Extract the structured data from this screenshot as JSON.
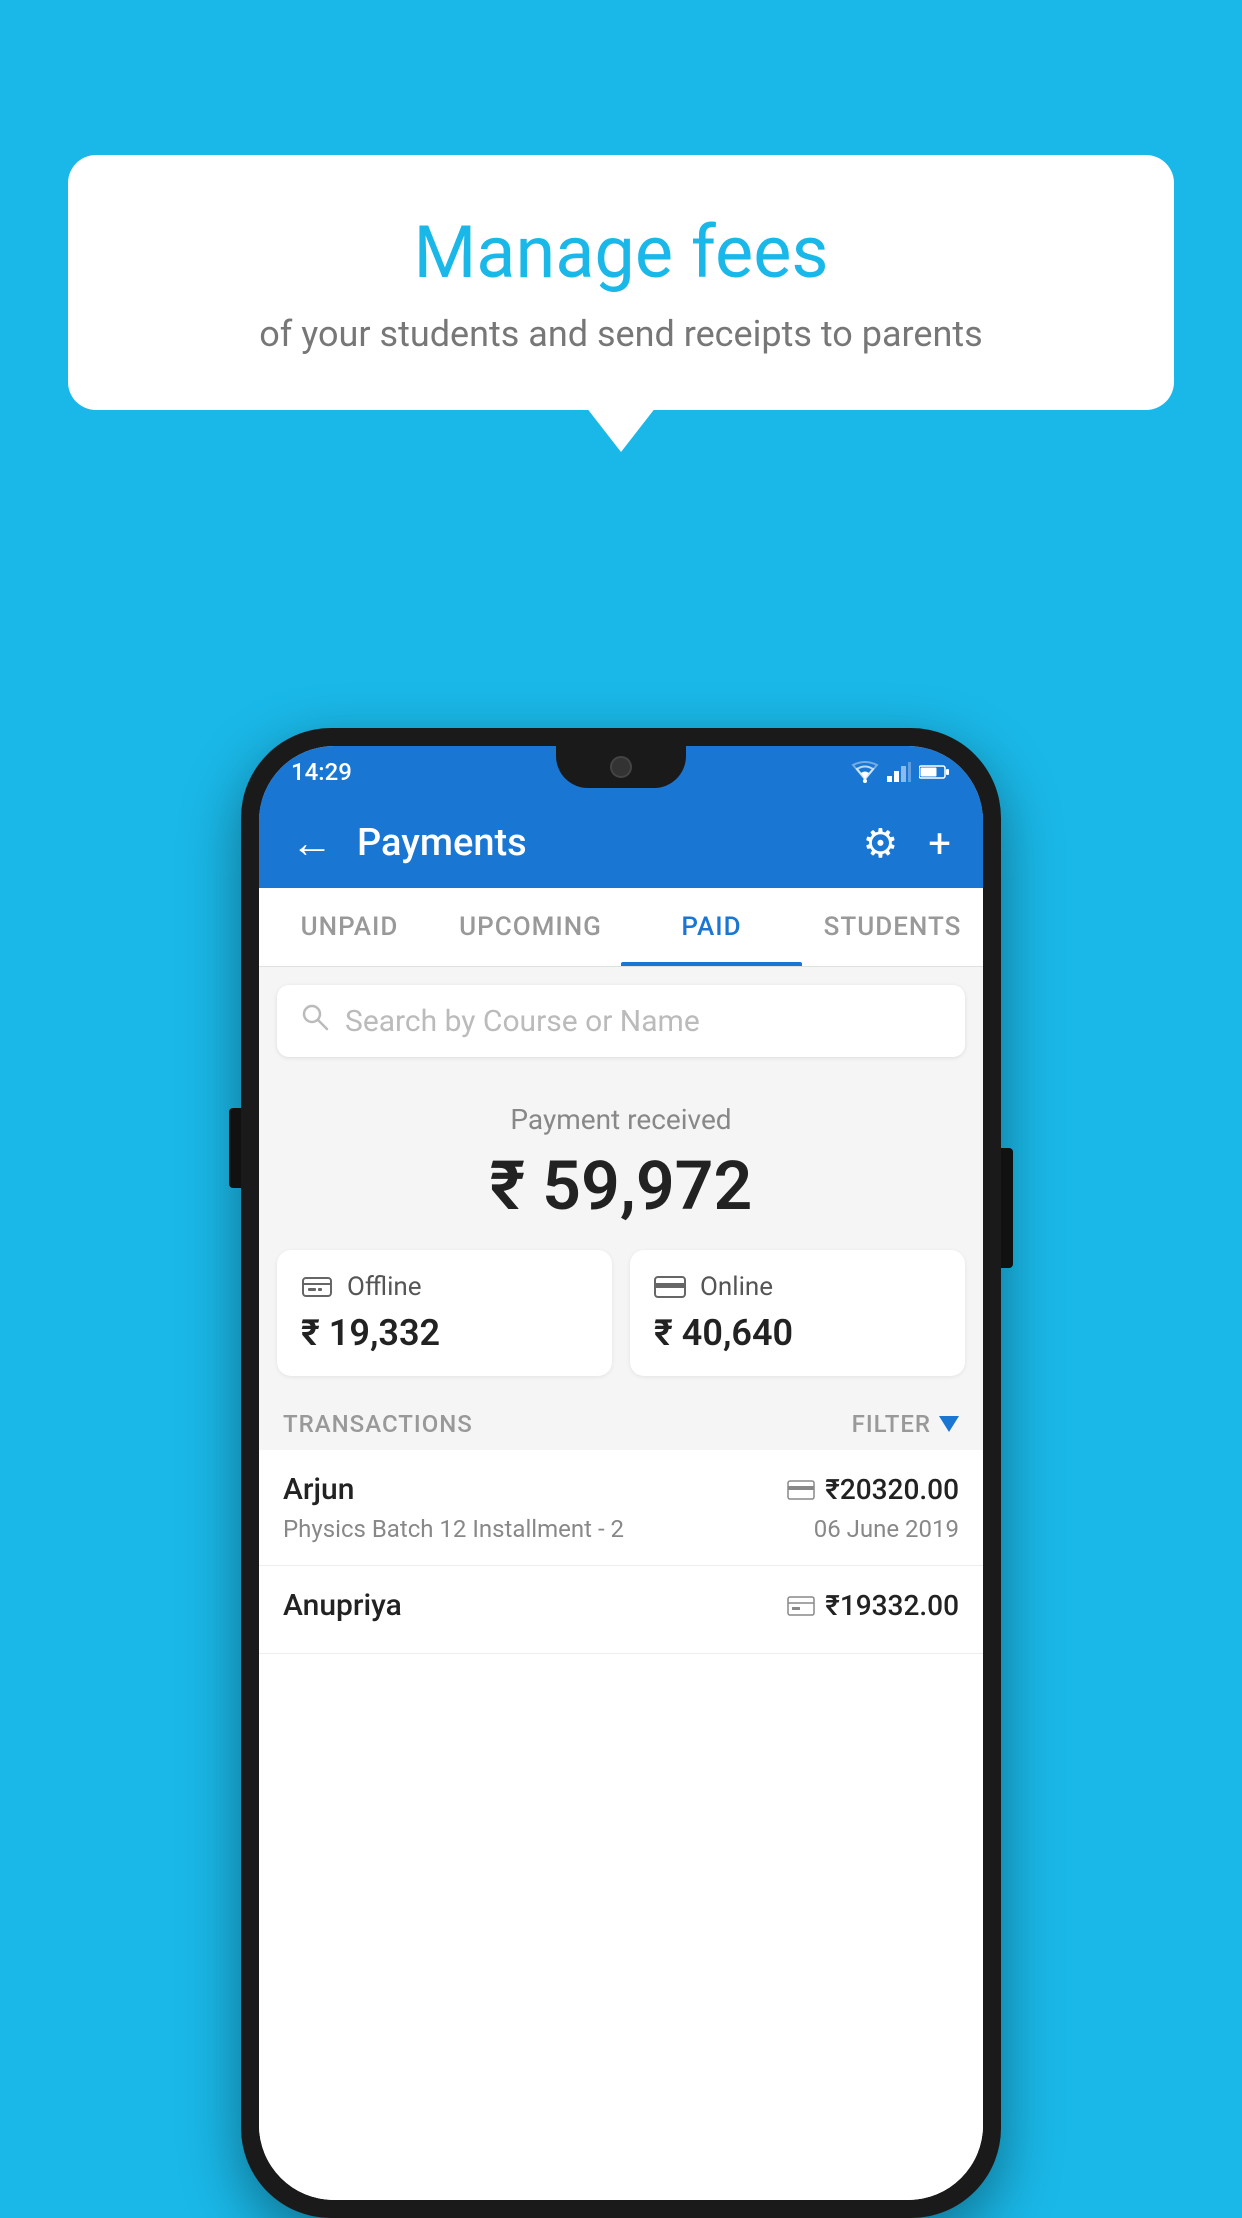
{
  "page": {
    "bg_color": "#1ab8e8"
  },
  "speech_bubble": {
    "title": "Manage fees",
    "subtitle": "of your students and send receipts to parents"
  },
  "phone": {
    "status_bar": {
      "time": "14:29"
    },
    "app_bar": {
      "title": "Payments",
      "back_label": "←",
      "gear_label": "⚙",
      "plus_label": "+"
    },
    "tabs": [
      {
        "id": "unpaid",
        "label": "UNPAID",
        "active": false
      },
      {
        "id": "upcoming",
        "label": "UPCOMING",
        "active": false
      },
      {
        "id": "paid",
        "label": "PAID",
        "active": true
      },
      {
        "id": "students",
        "label": "STUDENTS",
        "active": false
      }
    ],
    "search": {
      "placeholder": "Search by Course or Name"
    },
    "payment_received": {
      "label": "Payment received",
      "amount": "₹ 59,972"
    },
    "payment_cards": [
      {
        "id": "offline",
        "label": "Offline",
        "amount": "₹ 19,332",
        "icon": "offline"
      },
      {
        "id": "online",
        "label": "Online",
        "amount": "₹ 40,640",
        "icon": "online"
      }
    ],
    "transactions": {
      "header_label": "TRANSACTIONS",
      "filter_label": "FILTER",
      "rows": [
        {
          "name": "Arjun",
          "course": "Physics Batch 12 Installment - 2",
          "amount": "₹20320.00",
          "date": "06 June 2019",
          "payment_type": "online"
        },
        {
          "name": "Anupriya",
          "course": "",
          "amount": "₹19332.00",
          "date": "",
          "payment_type": "offline"
        }
      ]
    }
  }
}
